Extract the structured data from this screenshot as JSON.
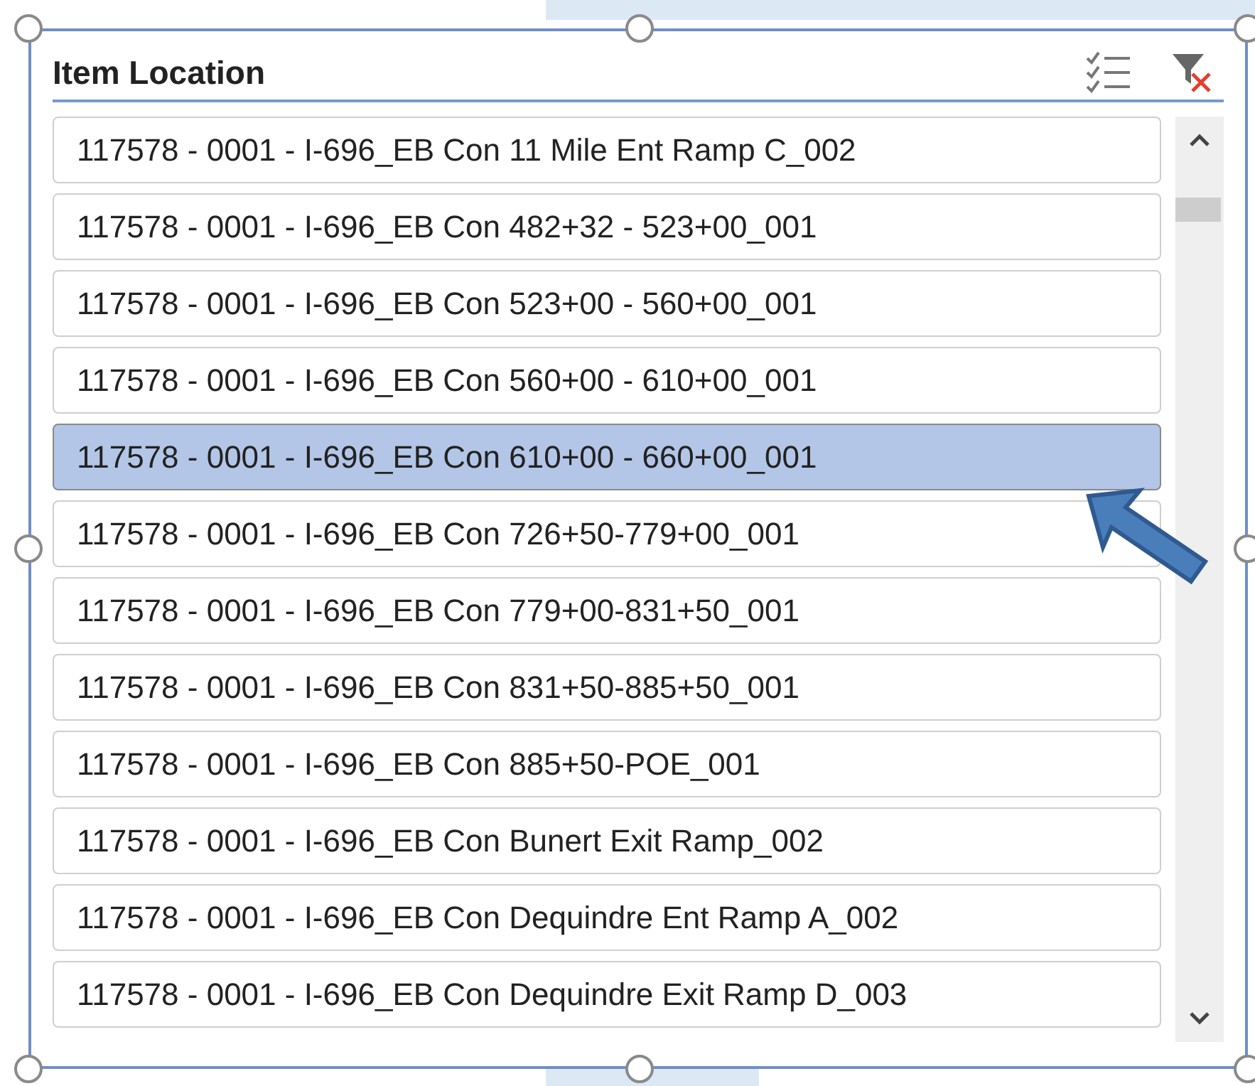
{
  "slicer": {
    "title": "Item Location",
    "items": [
      {
        "label": "117578 - 0001 - I-696_EB Con 11 Mile Ent Ramp C_002",
        "selected": false
      },
      {
        "label": "117578 - 0001 - I-696_EB Con 482+32 - 523+00_001",
        "selected": false
      },
      {
        "label": "117578 - 0001 - I-696_EB Con 523+00 - 560+00_001",
        "selected": false
      },
      {
        "label": "117578 - 0001 - I-696_EB Con 560+00 - 610+00_001",
        "selected": false
      },
      {
        "label": "117578 - 0001 - I-696_EB Con 610+00 - 660+00_001",
        "selected": true
      },
      {
        "label": "117578 - 0001 - I-696_EB Con 726+50-779+00_001",
        "selected": false
      },
      {
        "label": "117578 - 0001 - I-696_EB Con 779+00-831+50_001",
        "selected": false
      },
      {
        "label": "117578 - 0001 - I-696_EB Con 831+50-885+50_001",
        "selected": false
      },
      {
        "label": "117578 - 0001 - I-696_EB Con 885+50-POE_001",
        "selected": false
      },
      {
        "label": "117578 - 0001 - I-696_EB Con Bunert Exit Ramp_002",
        "selected": false
      },
      {
        "label": "117578 - 0001 - I-696_EB Con Dequindre Ent Ramp A_002",
        "selected": false
      },
      {
        "label": "117578 - 0001 - I-696_EB Con Dequindre Exit Ramp D_003",
        "selected": false
      }
    ]
  }
}
